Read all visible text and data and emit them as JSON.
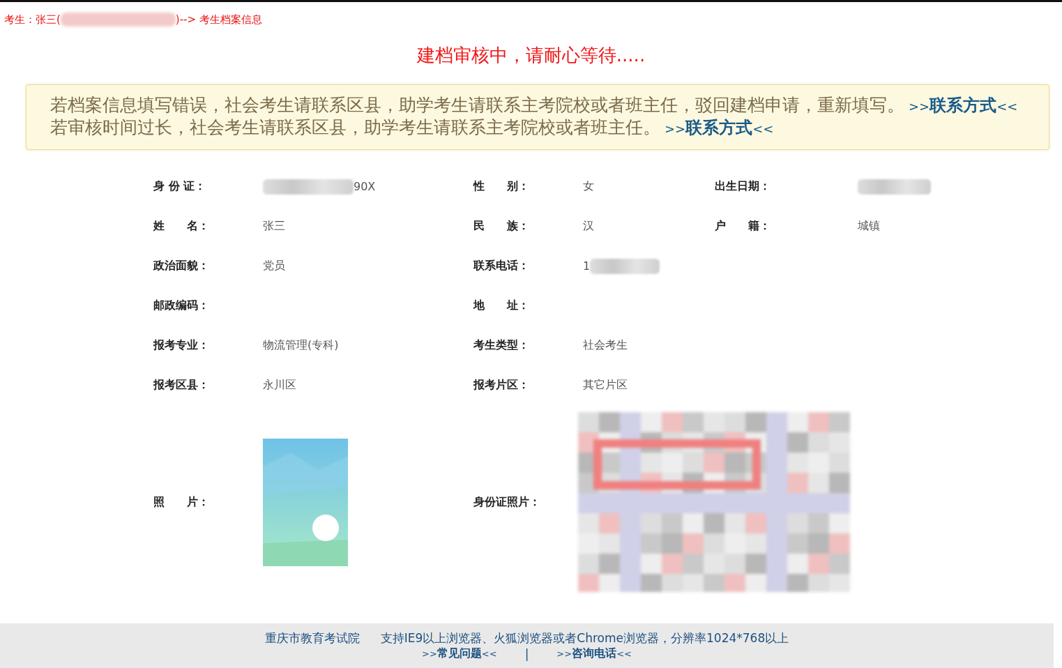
{
  "breadcrumb": {
    "prefix": "考生：张三(",
    "suffix": ")--> 考生档案信息"
  },
  "status_message": "建档审核中，请耐心等待.....",
  "notice": [
    {
      "text": "若档案信息填写错误，社会考生请联系区县，助学考生请联系主考院校或者班主任，驳回建档申请，重新填写。",
      "link": ">>**联系方式**<<"
    },
    {
      "text": "若审核时间过长，社会考生请联系区县，助学考生请联系主考院校或者班主任。",
      "link": ">>**联系方式**<<"
    }
  ],
  "fields": [
    [
      {
        "label": "身 份 证：",
        "value": "90X",
        "kind": "blurred_prefix"
      },
      {
        "label": "性　　别：",
        "value": "女",
        "kind": "text"
      },
      {
        "label": "出生日期：",
        "kind": "blurred"
      }
    ],
    [
      {
        "label": "姓　　名：",
        "value": "张三"
      },
      {
        "label": "民　　族：",
        "value": "汉"
      },
      {
        "label": "户　　籍：",
        "value": "城镇"
      }
    ],
    [
      {
        "label": "政治面貌：",
        "value": "党员"
      },
      {
        "label": "联系电话：",
        "value": "1",
        "kind": "blurred_suffix"
      }
    ],
    [
      {
        "label": "邮政编码："
      },
      {
        "label": "地　　址："
      }
    ],
    [
      {
        "label": "报考专业：",
        "value": "物流管理(专科)"
      },
      {
        "label": "考生类型：",
        "value": "社会考生"
      }
    ],
    [
      {
        "label": "报考区县：",
        "value": "永川区"
      },
      {
        "label": "报考片区：",
        "value": "其它片区"
      }
    ]
  ],
  "photos": [
    {
      "label": "照　　片：",
      "kind": "picture"
    },
    {
      "label": "身份证照片：",
      "kind": "redacted_picture"
    }
  ],
  "footer": {
    "org": "重庆市教育考试院",
    "support": "支持IE9以上浏览器、火狐浏览器或者Chrome浏览器，分辨率1024*768以上",
    "links": [
      ">>**常见问题**<<",
      ">>**咨询电话**<<"
    ],
    "separator": "|"
  }
}
